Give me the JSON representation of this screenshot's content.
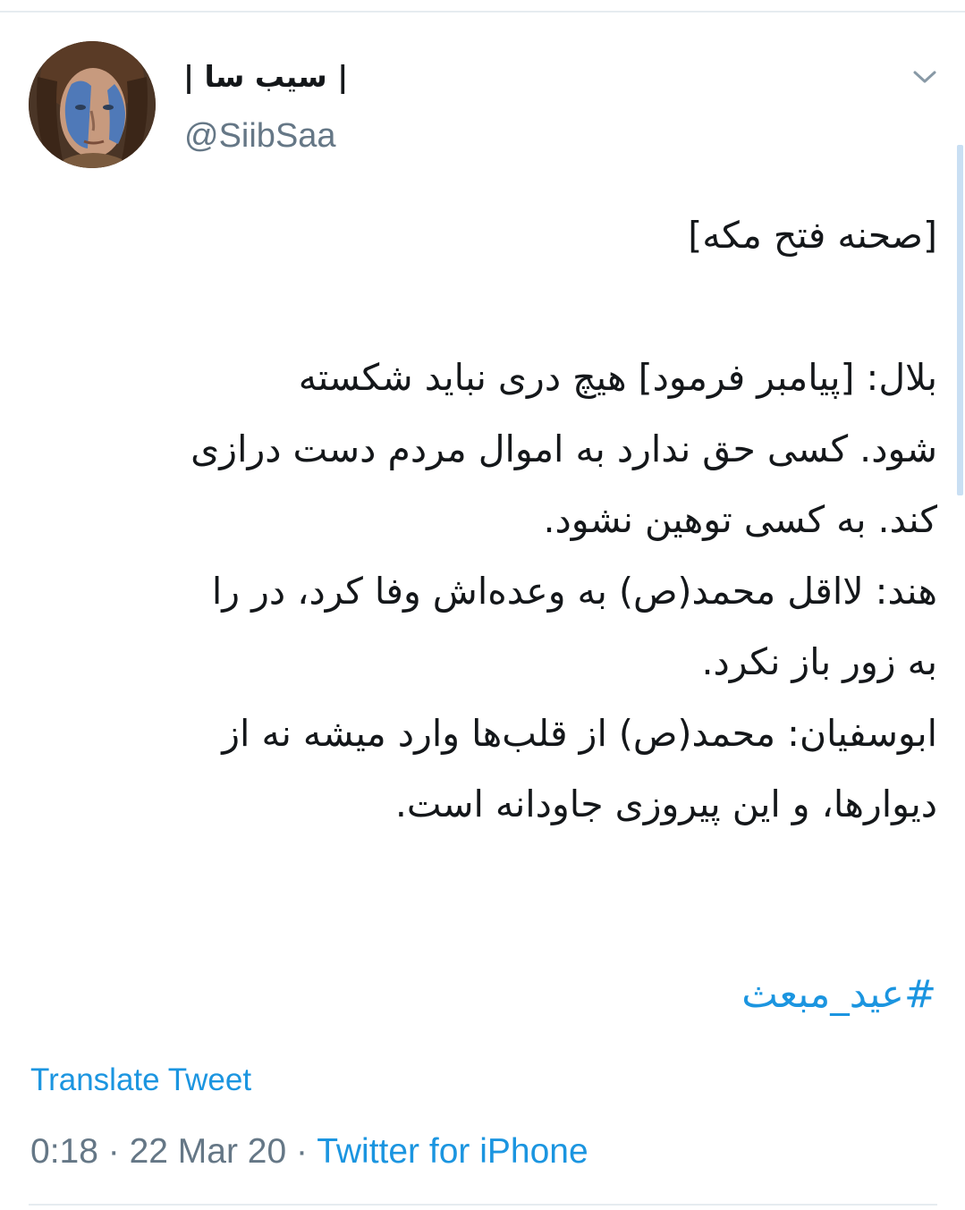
{
  "tweet": {
    "author": {
      "display_name": "| سیب سا |",
      "handle": "@SiibSaa"
    },
    "text_lines": [
      "[صحنه فتح مکه]",
      "",
      "بلال: [پیامبر فرمود] هیچ دری نباید شکسته",
      "شود. کسی حق ندارد به اموال مردم دست درازی",
      "کند. به کسی توهین نشود.",
      "هند: لااقل محمد(ص) به وعده‌اش وفا کرد، در را",
      "به زور باز نکرد.",
      "ابوسفیان: محمد(ص) از قلب‌ها وارد میشه نه از",
      "دیوارها، و این پیروزی جاودانه است."
    ],
    "hashtag": "#عید_مبعث",
    "translate_label": "Translate Tweet",
    "time": "0:18",
    "date": "22 Mar 20",
    "separator": "·",
    "source": "Twitter for iPhone"
  },
  "icons": {
    "menu": "chevron-down-icon",
    "avatar": "profile-avatar"
  },
  "colors": {
    "link": "#1b95e0",
    "secondary": "#657786",
    "text": "#14171a",
    "divider": "#e6ecf0"
  }
}
